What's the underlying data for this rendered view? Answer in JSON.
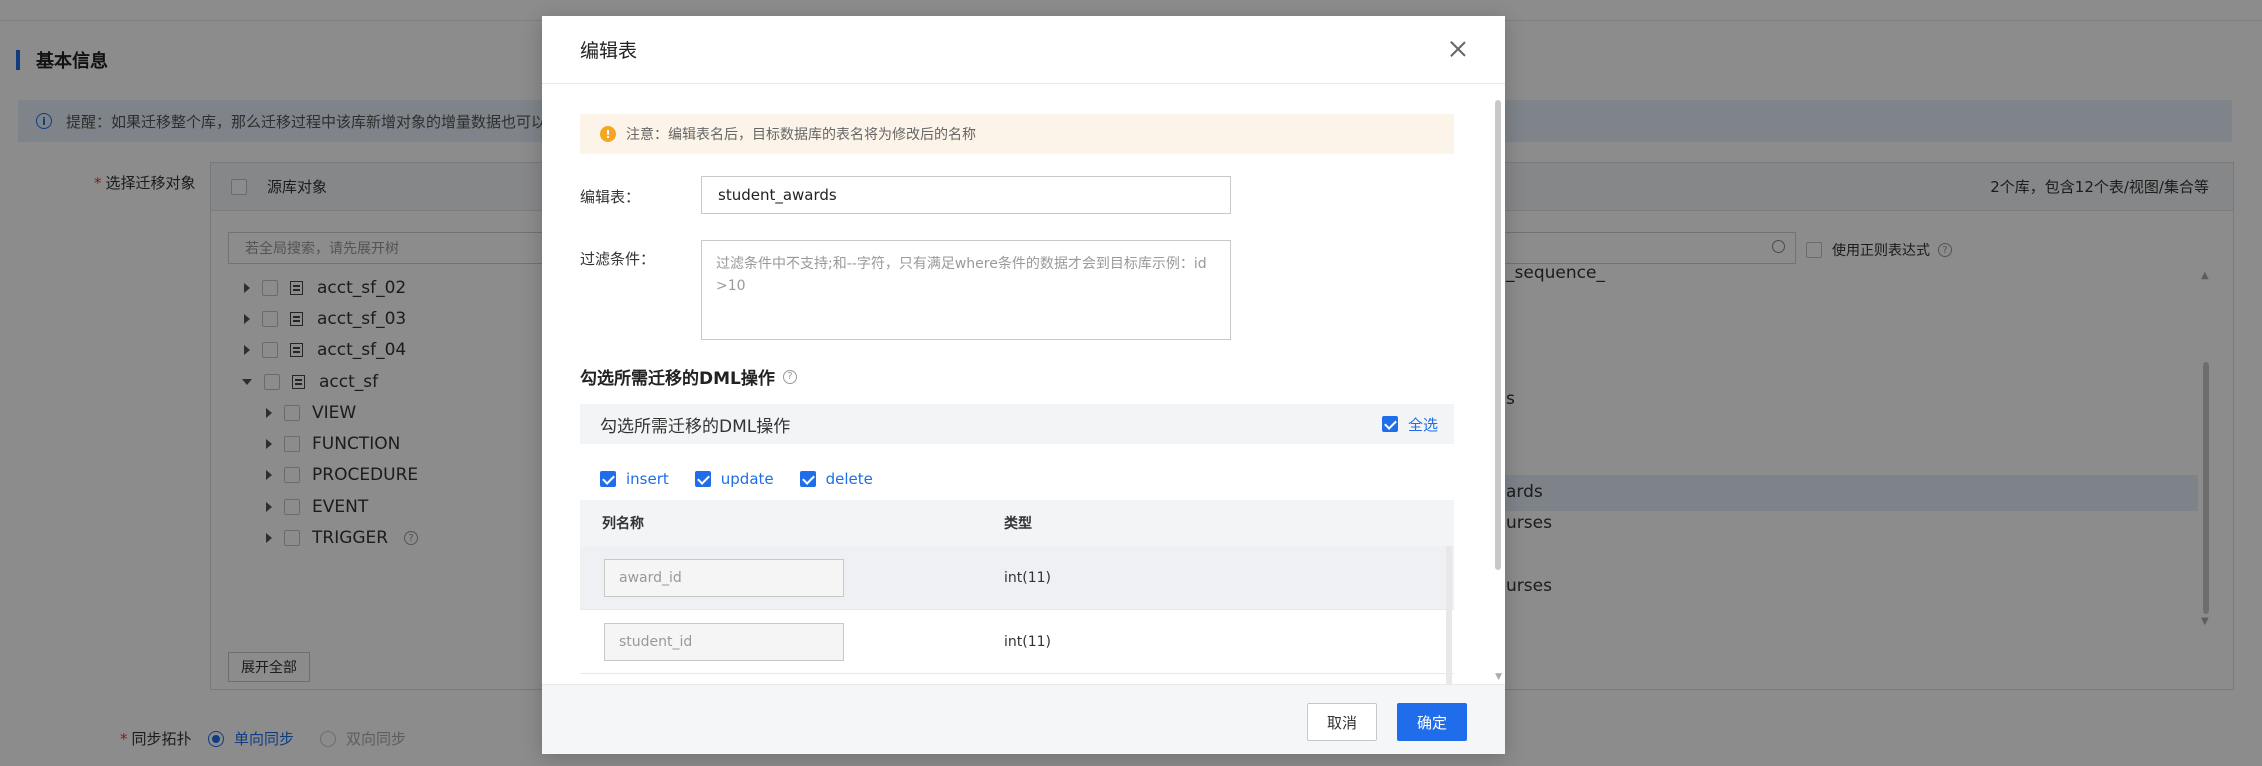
{
  "page": {
    "section_title": "基本信息",
    "tip": "提醒：如果迁移整个库，那么迁移过程中该库新增对象的增量数据也可以迁",
    "select_label": "选择迁移对象",
    "source_header": "源库对象",
    "right_count": "2个库，包含12个表/视图/集合等",
    "search_placeholder": "若全局搜索，请先展开树",
    "regex_label": "使用正则表达式",
    "tree": [
      {
        "label": "acct_sf_02",
        "type": "db",
        "expanded": false
      },
      {
        "label": "acct_sf_03",
        "type": "db",
        "expanded": false
      },
      {
        "label": "acct_sf_04",
        "type": "db",
        "expanded": false
      },
      {
        "label": "acct_sf",
        "type": "db",
        "expanded": true
      },
      {
        "label": "VIEW",
        "type": "group"
      },
      {
        "label": "FUNCTION",
        "type": "group"
      },
      {
        "label": "PROCEDURE",
        "type": "group"
      },
      {
        "label": "EVENT",
        "type": "group"
      },
      {
        "label": "TRIGGER",
        "type": "group"
      }
    ],
    "right_fragments": [
      "_sequence_",
      "s",
      "ards",
      "urses",
      "urses"
    ],
    "expand_all": "展开全部",
    "sync_label": "同步拓扑",
    "sync_options": [
      {
        "label": "单向同步",
        "selected": true
      },
      {
        "label": "双向同步",
        "selected": false
      }
    ]
  },
  "modal": {
    "title": "编辑表",
    "warning": "注意：编辑表名后，目标数据库的表名将为修改后的名称",
    "edit_table_label": "编辑表：",
    "edit_table_value": "student_awards",
    "filter_label": "过滤条件：",
    "filter_placeholder": "过滤条件中不支持;和--字符，只有满足where条件的数据才会到目标库示例：id >10",
    "dml_title": "勾选所需迁移的DML操作",
    "dml_box_title": "勾选所需迁移的DML操作",
    "select_all": "全选",
    "ops": [
      {
        "label": "insert",
        "checked": true
      },
      {
        "label": "update",
        "checked": true
      },
      {
        "label": "delete",
        "checked": true
      }
    ],
    "columns_header": {
      "name": "列名称",
      "type": "类型"
    },
    "columns": [
      {
        "name": "award_id",
        "type": "int(11)"
      },
      {
        "name": "student_id",
        "type": "int(11)"
      }
    ],
    "cancel": "取消",
    "ok": "确定"
  },
  "colors": {
    "accent": "#1f6dea",
    "warning": "#f5a623",
    "required": "#e53935"
  }
}
